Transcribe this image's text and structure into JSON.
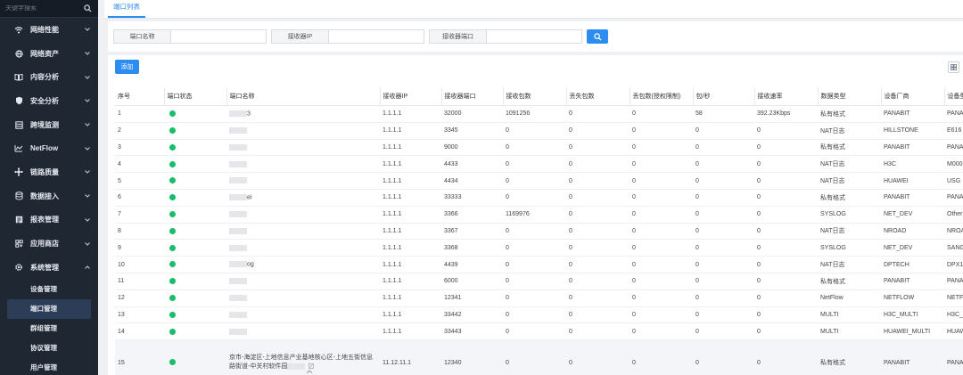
{
  "sidebar": {
    "search_placeholder": "关键字搜索",
    "items": [
      {
        "label": "网络性能",
        "icon": "wifi-icon"
      },
      {
        "label": "网络资产",
        "icon": "globe-icon"
      },
      {
        "label": "内容分析",
        "icon": "book-icon"
      },
      {
        "label": "安全分析",
        "icon": "shield-icon"
      },
      {
        "label": "跨境监测",
        "icon": "server-icon"
      },
      {
        "label": "NetFlow",
        "icon": "flow-icon"
      },
      {
        "label": "链路质量",
        "icon": "link-icon"
      },
      {
        "label": "数据接入",
        "icon": "database-icon"
      },
      {
        "label": "报表管理",
        "icon": "report-icon"
      },
      {
        "label": "应用商店",
        "icon": "store-icon"
      },
      {
        "label": "系统管理",
        "icon": "gear-icon",
        "expanded": true
      }
    ],
    "sub_items": [
      {
        "label": "设备管理",
        "active": false
      },
      {
        "label": "端口管理",
        "active": true
      },
      {
        "label": "群组管理",
        "active": false
      },
      {
        "label": "协议管理",
        "active": false
      },
      {
        "label": "用户管理",
        "active": false
      }
    ]
  },
  "tabs": [
    {
      "label": "端口列表",
      "active": true
    }
  ],
  "filter": {
    "fields": [
      {
        "label": "端口名称",
        "value": ""
      },
      {
        "label": "接收器IP",
        "value": ""
      },
      {
        "label": "接收器端口",
        "value": ""
      }
    ]
  },
  "toolbar": {
    "add_label": "添加"
  },
  "table": {
    "columns": [
      "序号",
      "端口状态",
      "端口名称",
      "接收器IP",
      "接收器端口",
      "接收包数",
      "丢失包数",
      "丢包数(授权限制)",
      "包/秒",
      "接收速率",
      "数据类型",
      "设备厂商",
      "设备型号"
    ],
    "rows": [
      {
        "no": "1",
        "status": "online",
        "name": "",
        "name_suffix": "3",
        "ip": "1.1.1.1",
        "port": "32000",
        "recv": "1091256",
        "lost": "0",
        "lost_lic": "0",
        "pps": "58",
        "rate": "392.23Kbps",
        "type": "私有格式",
        "vendor": "PANABIT",
        "model": "PANA"
      },
      {
        "no": "2",
        "status": "online",
        "name": "",
        "name_suffix": "",
        "ip": "1.1.1.1",
        "port": "3345",
        "recv": "0",
        "lost": "0",
        "lost_lic": "0",
        "pps": "0",
        "rate": "0",
        "type": "NAT日志",
        "vendor": "HILLSTONE",
        "model": "E616"
      },
      {
        "no": "3",
        "status": "online",
        "name": "",
        "name_suffix": "",
        "ip": "1.1.1.1",
        "port": "9000",
        "recv": "0",
        "lost": "0",
        "lost_lic": "0",
        "pps": "0",
        "rate": "0",
        "type": "私有格式",
        "vendor": "PANABIT",
        "model": "PANA"
      },
      {
        "no": "4",
        "status": "online",
        "name": "",
        "name_suffix": "",
        "ip": "1.1.1.1",
        "port": "4433",
        "recv": "0",
        "lost": "0",
        "lost_lic": "0",
        "pps": "0",
        "rate": "0",
        "type": "NAT日志",
        "vendor": "H3C",
        "model": "M000"
      },
      {
        "no": "5",
        "status": "online",
        "name": "",
        "name_suffix": "",
        "ip": "1.1.1.1",
        "port": "4434",
        "recv": "0",
        "lost": "0",
        "lost_lic": "0",
        "pps": "0",
        "rate": "0",
        "type": "NAT日志",
        "vendor": "HUAWEI",
        "model": "USG"
      },
      {
        "no": "6",
        "status": "online",
        "name": "",
        "name_suffix": "ei",
        "ip": "1.1.1.1",
        "port": "33333",
        "recv": "0",
        "lost": "0",
        "lost_lic": "0",
        "pps": "0",
        "rate": "0",
        "type": "私有格式",
        "vendor": "PANABIT",
        "model": "PANA"
      },
      {
        "no": "7",
        "status": "online",
        "name": "",
        "name_suffix": "",
        "ip": "1.1.1.1",
        "port": "3366",
        "recv": "1169976",
        "lost": "0",
        "lost_lic": "0",
        "pps": "0",
        "rate": "0",
        "type": "SYSLOG",
        "vendor": "NET_DEV",
        "model": "Other"
      },
      {
        "no": "8",
        "status": "online",
        "name": "",
        "name_suffix": "",
        "ip": "1.1.1.1",
        "port": "3367",
        "recv": "0",
        "lost": "0",
        "lost_lic": "0",
        "pps": "0",
        "rate": "0",
        "type": "NAT日志",
        "vendor": "NROAD",
        "model": "NROA"
      },
      {
        "no": "9",
        "status": "online",
        "name": "",
        "name_suffix": "",
        "ip": "1.1.1.1",
        "port": "3368",
        "recv": "0",
        "lost": "0",
        "lost_lic": "0",
        "pps": "0",
        "rate": "0",
        "type": "SYSLOG",
        "vendor": "NET_DEV",
        "model": "SANG"
      },
      {
        "no": "10",
        "status": "online",
        "name": "",
        "name_suffix": "og",
        "ip": "1.1.1.1",
        "port": "4439",
        "recv": "0",
        "lost": "0",
        "lost_lic": "0",
        "pps": "0",
        "rate": "0",
        "type": "NAT日志",
        "vendor": "DPTECH",
        "model": "DPX1"
      },
      {
        "no": "11",
        "status": "online",
        "name": "",
        "name_suffix": "",
        "ip": "1.1.1.1",
        "port": "6000",
        "recv": "0",
        "lost": "0",
        "lost_lic": "0",
        "pps": "0",
        "rate": "0",
        "type": "私有格式",
        "vendor": "PANABIT",
        "model": "PANA"
      },
      {
        "no": "12",
        "status": "online",
        "name": "",
        "name_suffix": "",
        "ip": "1.1.1.1",
        "port": "12341",
        "recv": "0",
        "lost": "0",
        "lost_lic": "0",
        "pps": "0",
        "rate": "0",
        "type": "NetFlow",
        "vendor": "NETFLOW",
        "model": "NETF"
      },
      {
        "no": "13",
        "status": "online",
        "name": "",
        "name_suffix": "",
        "ip": "1.1.1.1",
        "port": "33442",
        "recv": "0",
        "lost": "0",
        "lost_lic": "0",
        "pps": "0",
        "rate": "0",
        "type": "MULTI",
        "vendor": "H3C_MULTI",
        "model": "H3C_"
      },
      {
        "no": "14",
        "status": "online",
        "name": "",
        "name_suffix": "",
        "ip": "1.1.1.1",
        "port": "33443",
        "recv": "0",
        "lost": "0",
        "lost_lic": "0",
        "pps": "0",
        "rate": "0",
        "type": "MULTI",
        "vendor": "HUAWEI_MULTI",
        "model": "HUAW"
      },
      {
        "no": "15",
        "status": "online",
        "name": "京市-海淀区-上地信息产业基地核心区-上地五街信息路街道-中关村软件园",
        "name_suffix": "",
        "ip": "11.12.11.1",
        "port": "12340",
        "recv": "0",
        "lost": "0",
        "lost_lic": "0",
        "pps": "0",
        "rate": "0",
        "type": "私有格式",
        "vendor": "PANABIT",
        "model": "PANA",
        "tall": true
      }
    ]
  },
  "colors": {
    "accent": "#2d8cf0",
    "sidebar_bg": "#1f2733",
    "status_online": "#19be6b"
  }
}
